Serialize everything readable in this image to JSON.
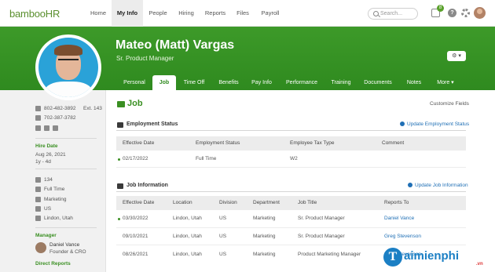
{
  "topnav": {
    "logo": "bambooHR",
    "items": [
      "Home",
      "My Info",
      "People",
      "Hiring",
      "Reports",
      "Files",
      "Payroll"
    ],
    "active": "My Info",
    "search_placeholder": "Search...",
    "inbox_count": "8",
    "help": "?"
  },
  "profile": {
    "name": "Mateo (Matt) Vargas",
    "title": "Sr. Product Manager",
    "settings": "⚙ ▾",
    "tabs": [
      "Personal",
      "Job",
      "Time Off",
      "Benefits",
      "Pay Info",
      "Performance",
      "Training",
      "Documents",
      "Notes",
      "More ▾"
    ],
    "active_tab": "Job"
  },
  "sidebar": {
    "phone_work": "802-482-3892",
    "ext": "Ext. 143",
    "phone_mobile": "702-387-3782",
    "hire_date_label": "Hire Date",
    "hire_date": "Aug 26, 2021",
    "tenure": "1y - 4d",
    "employee_number": "134",
    "employment": "Full Time",
    "department": "Marketing",
    "country": "US",
    "location": "Lindon, Utah",
    "manager_label": "Manager",
    "manager_name": "Daniel Vance",
    "manager_title": "Founder & CRO",
    "direct_reports_label": "Direct Reports"
  },
  "job": {
    "title": "Job",
    "customize": "Customize Fields",
    "employment_status": {
      "title": "Employment Status",
      "action": "Update Employment Status",
      "headers": [
        "Effective Date",
        "Employment Status",
        "Employee Tax Type",
        "Comment"
      ],
      "rows": [
        [
          "02/17/2022",
          "Full Time",
          "W2",
          ""
        ]
      ]
    },
    "job_information": {
      "title": "Job Information",
      "action": "Update Job Information",
      "headers": [
        "Effective Date",
        "Location",
        "Division",
        "Department",
        "Job Title",
        "Reports To"
      ],
      "rows": [
        [
          "03/30/2022",
          "Lindon, Utah",
          "US",
          "Marketing",
          "Sr. Product Manager",
          "Daniel Vance"
        ],
        [
          "09/10/2021",
          "Lindon, Utah",
          "US",
          "Marketing",
          "Sr. Product Manager",
          "Greg Stevenson"
        ],
        [
          "08/26/2021",
          "Lindon, Utah",
          "US",
          "Marketing",
          "Product Marketing Manager",
          "Greg Stevenson"
        ]
      ]
    }
  },
  "watermark": {
    "text": "aimienphi",
    "letter": "T",
    "suffix": ".vn"
  },
  "colors": {
    "brand_green": "#3a8f22",
    "link_blue": "#1f6fb5"
  }
}
